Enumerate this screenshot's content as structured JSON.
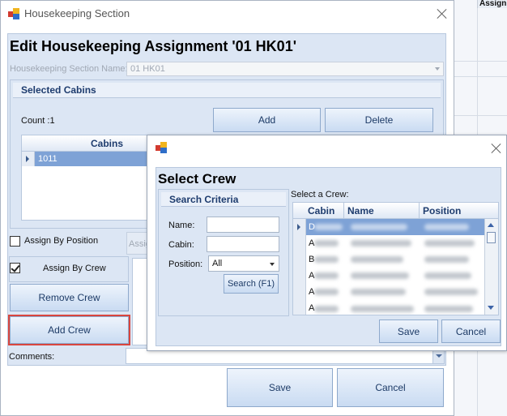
{
  "background_app": {
    "column_header": "Assign"
  },
  "main_window": {
    "title": "Housekeeping Section",
    "heading": "Edit Housekeeping Assignment '01 HK01'",
    "section_name_label": "Housekeeping Section Name:",
    "section_name_value": "01 HK01",
    "selected_cabins": {
      "title": "Selected Cabins",
      "count_label": "Count :1",
      "add_label": "Add",
      "delete_label": "Delete",
      "column_header": "Cabins",
      "rows": [
        "1011"
      ]
    },
    "assign_by_position": {
      "label": "Assign By Position",
      "checked": false
    },
    "assign_by_position_partial": "Assig",
    "assign_by_crew": {
      "label": "Assign By Crew",
      "checked": true
    },
    "remove_crew_label": "Remove Crew",
    "add_crew_label": "Add Crew",
    "comments_label": "Comments:",
    "save_label": "Save",
    "cancel_label": "Cancel"
  },
  "crew_dialog": {
    "heading": "Select Crew",
    "search_criteria_title": "Search Criteria",
    "name_label": "Name:",
    "name_value": "",
    "cabin_label": "Cabin:",
    "cabin_value": "",
    "position_label": "Position:",
    "position_value": "All",
    "search_label": "Search (F1)",
    "list_label": "Select a Crew:",
    "columns": {
      "cabin": "Cabin",
      "name": "Name",
      "position": "Position"
    },
    "row_prefixes": [
      "D",
      "A",
      "B",
      "A",
      "A",
      "A"
    ],
    "save_label": "Save",
    "cancel_label": "Cancel"
  }
}
